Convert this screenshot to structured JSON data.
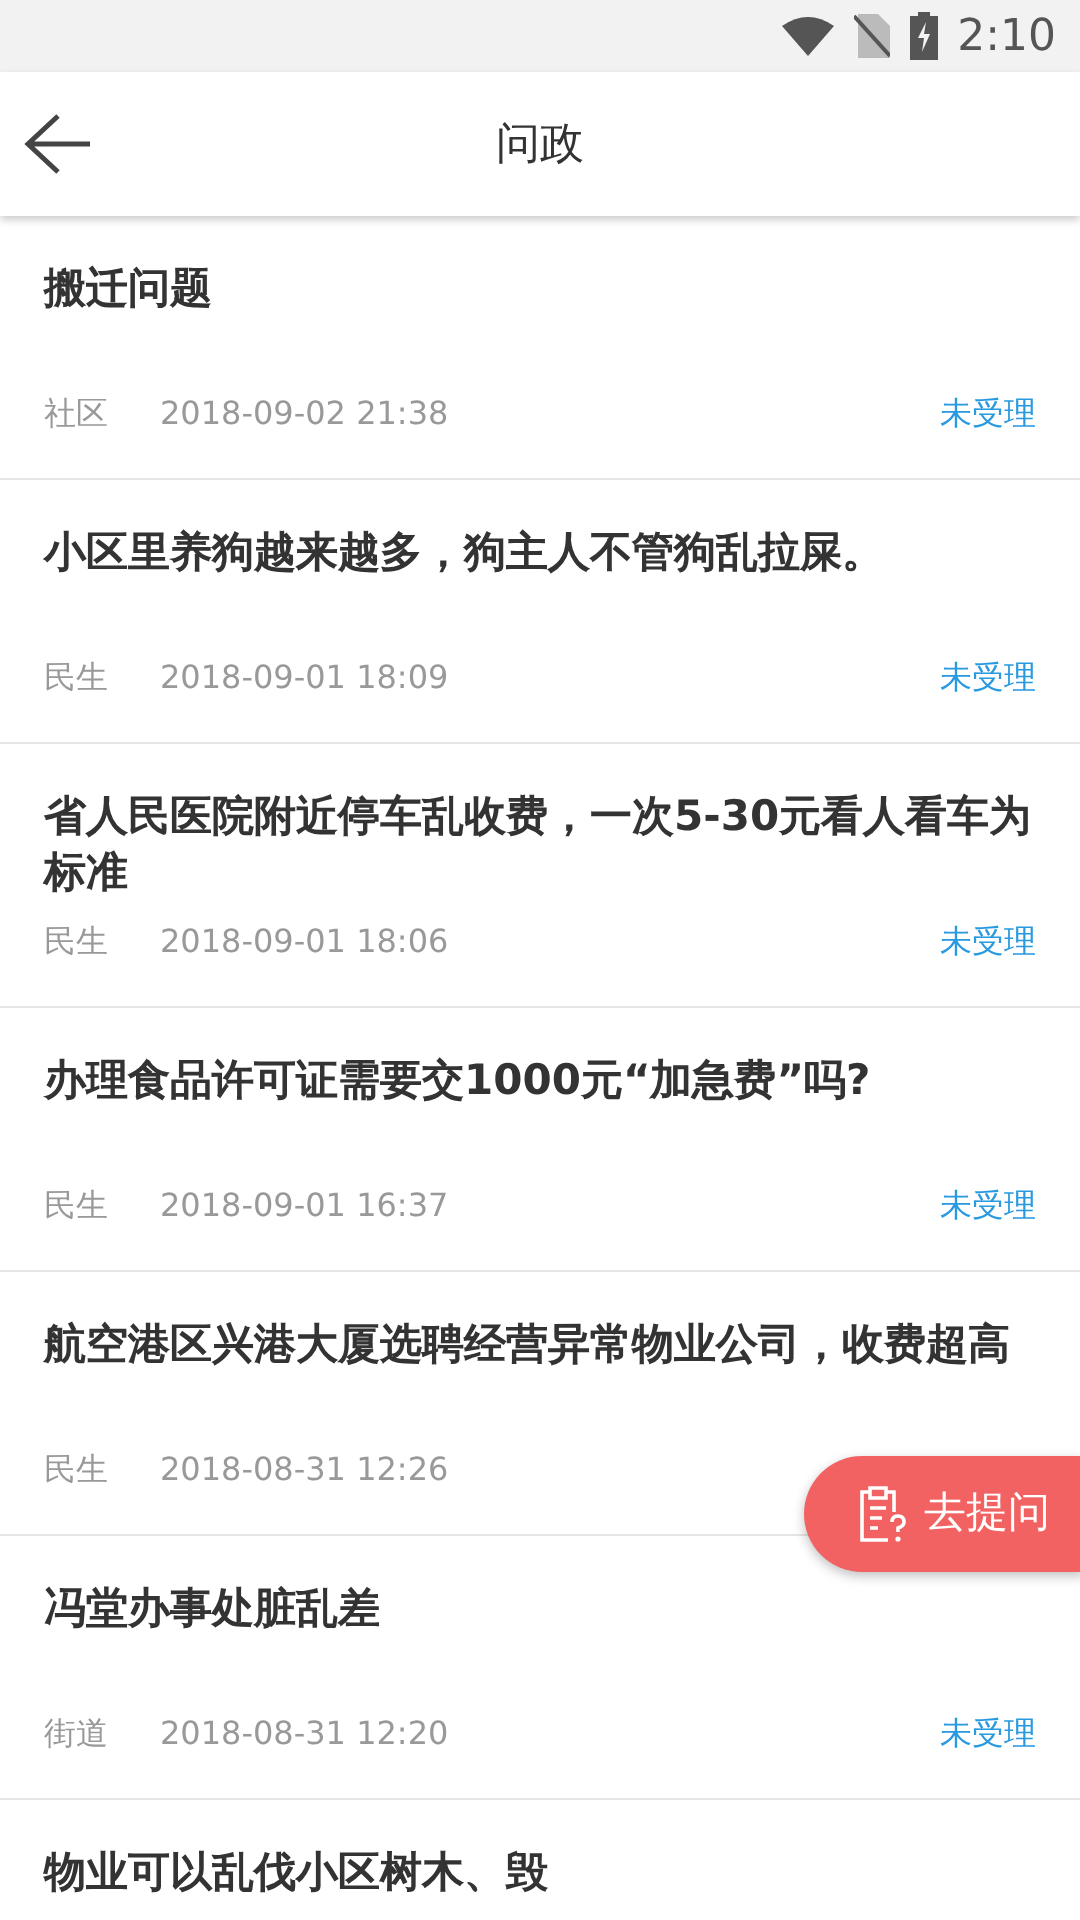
{
  "status_bar": {
    "time": "2:10"
  },
  "header": {
    "title": "问政"
  },
  "items": [
    {
      "title": "搬迁问题",
      "category": "社区",
      "date": "2018-09-02 21:38",
      "status": "未受理"
    },
    {
      "title": "小区里养狗越来越多，狗主人不管狗乱拉屎。",
      "category": "民生",
      "date": "2018-09-01 18:09",
      "status": "未受理"
    },
    {
      "title": "省人民医院附近停车乱收费，一次5-30元看人看车为标准",
      "category": "民生",
      "date": "2018-09-01 18:06",
      "status": "未受理"
    },
    {
      "title": "办理食品许可证需要交1000元“加急费”吗?",
      "category": "民生",
      "date": "2018-09-01 16:37",
      "status": "未受理"
    },
    {
      "title": "航空港区兴港大厦选聘经营异常物业公司，收费超高",
      "category": "民生",
      "date": "2018-08-31 12:26"
    },
    {
      "title": "冯堂办事处脏乱差",
      "category": "街道",
      "date": "2018-08-31 12:20",
      "status": "未受理"
    },
    {
      "title": "物业可以乱伐小区树木、毁"
    }
  ],
  "fab": {
    "label": "去提问"
  }
}
